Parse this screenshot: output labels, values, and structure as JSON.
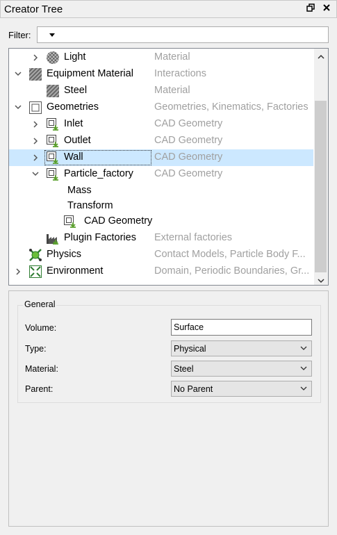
{
  "window": {
    "title": "Creator Tree",
    "float_icon": "restore-icon",
    "close_icon": "close-icon"
  },
  "filter": {
    "label": "Filter:",
    "value": ""
  },
  "tree": [
    {
      "label": "Light",
      "type": "Material",
      "icon": "material-sphere-icon",
      "expanded": false
    },
    {
      "label": "Equipment Material",
      "type": "Interactions",
      "icon": "hatched-material-icon",
      "expanded": true
    },
    {
      "label": "Steel",
      "type": "Material",
      "icon": "hatched-material-icon"
    },
    {
      "label": "Geometries",
      "type": "Geometries, Kinematics, Factories",
      "icon": "geometry-folder-icon",
      "expanded": true
    },
    {
      "label": "Inlet",
      "type": "CAD Geometry",
      "icon": "cad-geometry-icon",
      "expanded": false
    },
    {
      "label": "Outlet",
      "type": "CAD Geometry",
      "icon": "cad-geometry-icon",
      "expanded": false
    },
    {
      "label": "Wall",
      "type": "CAD Geometry",
      "icon": "cad-geometry-icon",
      "expanded": false,
      "selected": true
    },
    {
      "label": "Particle_factory",
      "type": "CAD Geometry",
      "icon": "cad-geometry-icon",
      "expanded": true
    },
    {
      "label": "Mass",
      "type": ""
    },
    {
      "label": "Transform",
      "type": ""
    },
    {
      "label": "CAD Geometry",
      "type": "",
      "icon": "cad-geometry-icon"
    },
    {
      "label": "Plugin Factories",
      "type": "External factories",
      "icon": "factory-icon"
    },
    {
      "label": "Physics",
      "type": "Contact Models, Particle Body F...",
      "icon": "physics-icon"
    },
    {
      "label": "Environment",
      "type": "Domain, Periodic Boundaries, Gr...",
      "icon": "environment-icon",
      "expanded": false
    }
  ],
  "properties": {
    "group_title": "General",
    "volume": {
      "label": "Volume:",
      "value": "Surface"
    },
    "type": {
      "label": "Type:",
      "value": "Physical"
    },
    "material": {
      "label": "Material:",
      "value": "Steel"
    },
    "parent": {
      "label": "Parent:",
      "value": "No Parent"
    }
  }
}
